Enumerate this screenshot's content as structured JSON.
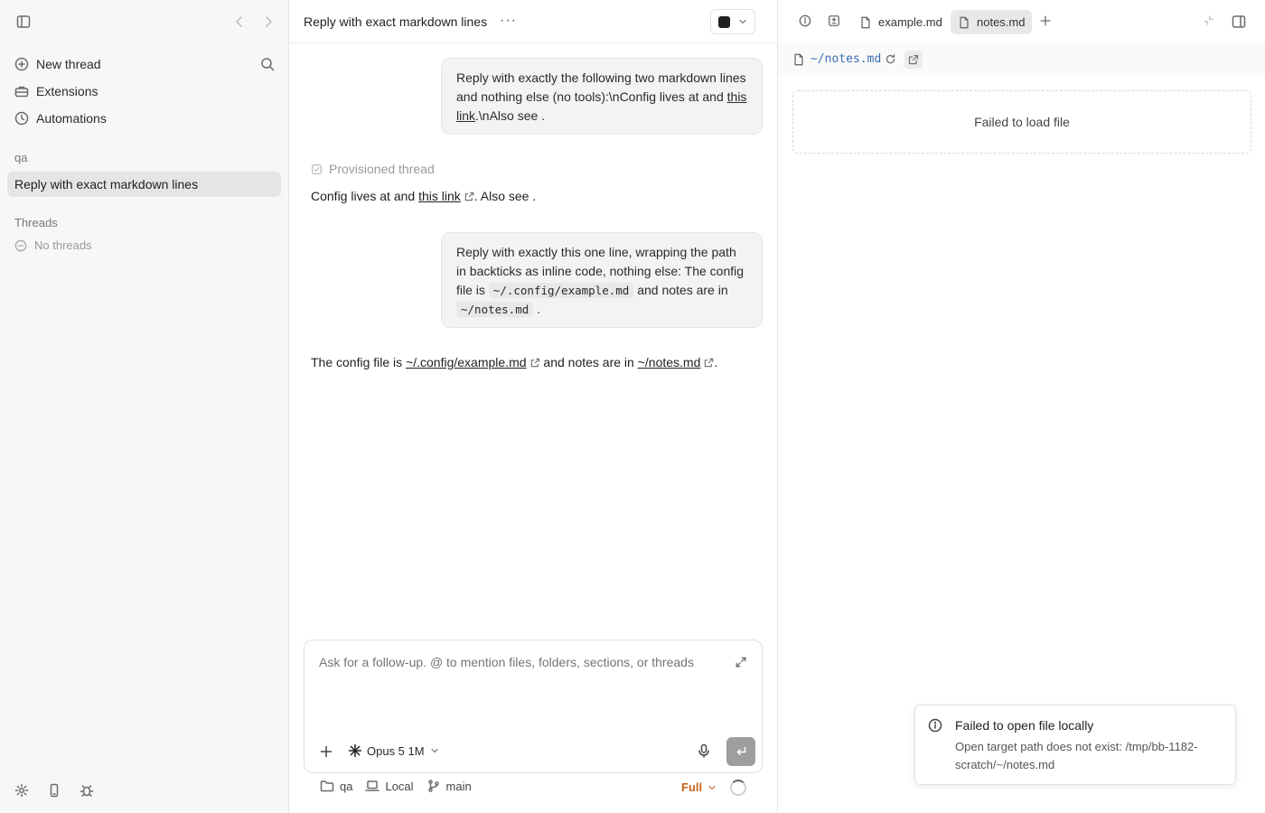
{
  "sidebar": {
    "nav": [
      {
        "label": "New thread",
        "icon": "plus-circle-icon"
      },
      {
        "label": "Extensions",
        "icon": "toolbox-icon"
      },
      {
        "label": "Automations",
        "icon": "clock-icon"
      }
    ],
    "project_label": "qa",
    "active_thread": "Reply with exact markdown lines",
    "threads_label": "Threads",
    "no_threads": "No threads"
  },
  "main": {
    "title": "Reply with exact markdown lines",
    "more": "···",
    "messages": {
      "user1": {
        "text_a": "Reply with exactly the following two markdown lines and nothing else (no tools):\\nConfig lives at and ",
        "link": "this link",
        "text_b": ".\\nAlso see ."
      },
      "provisioned": "Provisioned thread",
      "reply1": {
        "text_a": "Config lives at and ",
        "link": "this link",
        "text_b": ". Also see ."
      },
      "user2": {
        "text_a": "Reply with exactly this one line, wrapping the path in backticks as inline code, nothing else: The config file is ",
        "code1": "~/.config/example.md",
        "text_b": " and notes are in ",
        "code2": "~/notes.md",
        "text_c": " ."
      },
      "reply2": {
        "text_a": "The config file is ",
        "link1": "~/.config/example.md",
        "text_b": " and notes are in ",
        "link2": "~/notes.md",
        "text_c": "."
      }
    },
    "composer": {
      "placeholder": "Ask for a follow-up. @ to mention files, folders, sections, or threads",
      "model": "Opus 5 1M"
    },
    "footer": {
      "folder": "qa",
      "env": "Local",
      "branch": "main",
      "access": "Full"
    }
  },
  "panel": {
    "tabs": [
      {
        "label": "example.md",
        "active": false
      },
      {
        "label": "notes.md",
        "active": true
      }
    ],
    "path": "~/notes.md",
    "error": "Failed to load file"
  },
  "toast": {
    "title": "Failed to open file locally",
    "message": "Open target path does not exist: /tmp/bb-1182-scratch/~/notes.md"
  },
  "colors": {
    "accent_full": "#c7641b",
    "path_link": "#3b6fb5"
  }
}
